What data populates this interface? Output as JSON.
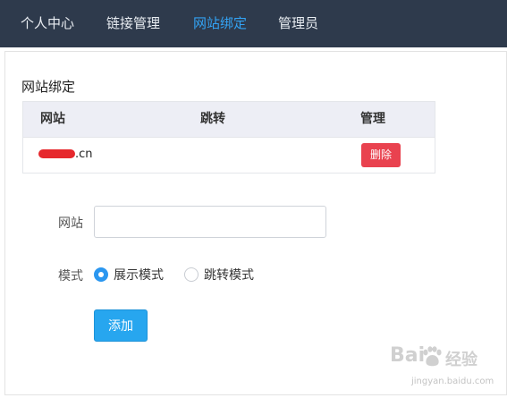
{
  "nav": {
    "items": [
      {
        "label": "个人中心",
        "active": false
      },
      {
        "label": "链接管理",
        "active": false
      },
      {
        "label": "网站绑定",
        "active": true
      },
      {
        "label": "管理员",
        "active": false
      }
    ],
    "background": "#2e3a4c",
    "active_color": "#33a3f4"
  },
  "panel": {
    "title": "网站绑定"
  },
  "table": {
    "headers": [
      "网站",
      "跳转",
      "管理"
    ],
    "rows": [
      {
        "site_visible_suffix": ".cn",
        "site_redacted": true,
        "redirect": "",
        "action_label": "删除"
      }
    ]
  },
  "form": {
    "site_label": "网站",
    "site_value": "",
    "site_placeholder": "",
    "mode_label": "模式",
    "mode_options": [
      {
        "label": "展示模式",
        "selected": true
      },
      {
        "label": "跳转模式",
        "selected": false
      }
    ],
    "submit_label": "添加"
  },
  "colors": {
    "delete_button": "#e9424f",
    "add_button": "#27a6ef",
    "radio_checked": "#2b97f0",
    "redaction": "#e6282d"
  },
  "watermark": {
    "brand_left": "Bai",
    "brand_right": "经验",
    "sub": "jingyan.baidu.com",
    "icon": "paw-icon"
  }
}
